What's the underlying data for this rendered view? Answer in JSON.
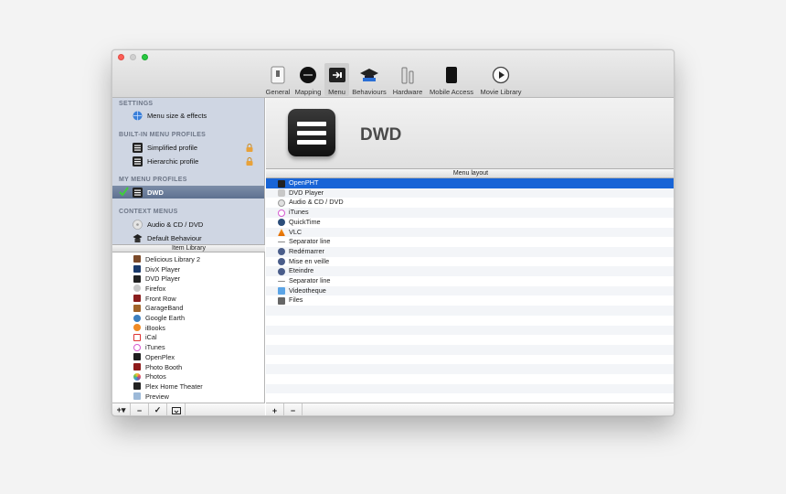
{
  "toolbar": {
    "items": [
      {
        "label": "General",
        "icon": "switch-icon"
      },
      {
        "label": "Mapping",
        "icon": "remote-icon"
      },
      {
        "label": "Menu",
        "icon": "menu-icon"
      },
      {
        "label": "Behaviours",
        "icon": "graduation-cap-icon"
      },
      {
        "label": "Hardware",
        "icon": "hardware-icon"
      },
      {
        "label": "Mobile Access",
        "icon": "phone-icon"
      },
      {
        "label": "Movie Library",
        "icon": "play-icon"
      }
    ],
    "active": "Menu"
  },
  "sidebar": {
    "settings_header": "SETTINGS",
    "settings_item": "Menu size & effects",
    "builtin_header": "BUILT-IN MENU PROFILES",
    "builtin_items": [
      "Simplified profile",
      "Hierarchic profile"
    ],
    "my_header": "MY MENU PROFILES",
    "my_items": [
      "DWD"
    ],
    "context_header": "CONTEXT MENUS",
    "context_items": [
      "Audio & CD / DVD",
      "Default Behaviour"
    ]
  },
  "library": {
    "header": "Item Library",
    "items": [
      "Delicious Library 2",
      "DivX Player",
      "DVD Player",
      "Firefox",
      "Front Row",
      "GarageBand",
      "Google Earth",
      "iBooks",
      "iCal",
      "iTunes",
      "OpenPlex",
      "Photo Booth",
      "Photos",
      "Plex Home Theater",
      "Preview"
    ]
  },
  "bottom_left": {
    "add": "+▾",
    "remove": "−",
    "check": "✓",
    "sync": "⇄"
  },
  "bottom_right": {
    "add": "+",
    "remove": "−"
  },
  "profile": {
    "title": "DWD"
  },
  "layout": {
    "header": "Menu layout",
    "items": [
      "OpenPHT",
      "DVD Player",
      "Audio & CD / DVD",
      "iTunes",
      "QuickTime",
      "VLC",
      "Separator line",
      "Redémarrer",
      "Mise en veille",
      "Eteindre",
      "Separator line",
      "Videotheque",
      "Files"
    ],
    "selected_index": 0
  },
  "colors": {
    "selection": "#1864d6",
    "sidebar_bg": "#cfd6e3"
  }
}
